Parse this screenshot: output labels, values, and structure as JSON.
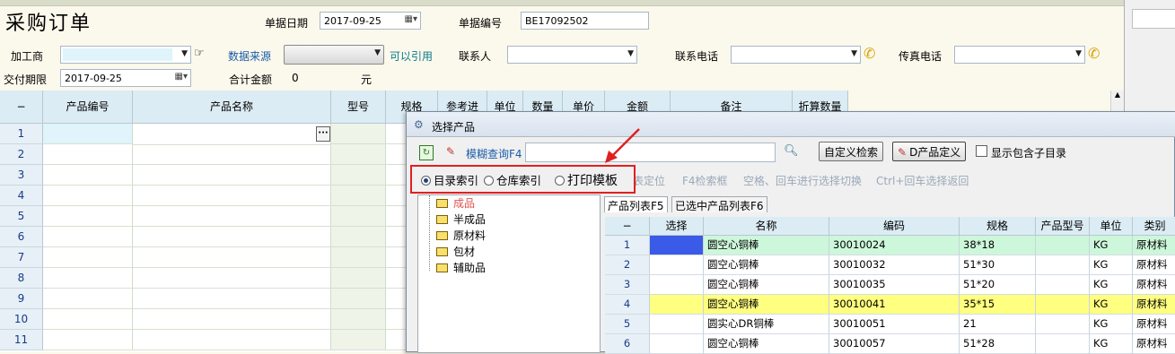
{
  "title": "采购订单",
  "header": {
    "date_label": "单据日期",
    "date_value": "2017-09-25",
    "doc_no_label": "单据编号",
    "doc_no_value": "BE17092502",
    "processor_label": "加工商",
    "processor_value": "",
    "source_label": "数据来源",
    "source_value": "",
    "quote_label": "可以引用",
    "contact_label": "联系人",
    "contact_value": "",
    "phone_label": "联系电话",
    "phone_value": "",
    "fax_label": "传真电话",
    "fax_value": "",
    "due_label": "交付期限",
    "due_value": "2017-09-25",
    "total_label": "合计金额",
    "total_value": "0",
    "currency": "元"
  },
  "grid": {
    "columns": [
      "−",
      "产品编号",
      "产品名称",
      "型号",
      "规格",
      "参考进",
      "单位",
      "数量",
      "单价",
      "金额",
      "备注",
      "折算数量"
    ],
    "rows": [
      "1",
      "2",
      "3",
      "4",
      "5",
      "6",
      "7",
      "8",
      "9",
      "10",
      "11"
    ],
    "cell_button": "···"
  },
  "dialog": {
    "title": "选择产品",
    "fuzzy_label": "模糊查询F4",
    "search_value": "",
    "custom_search": "自定义检索",
    "d_define": "D产品定义",
    "show_sub": "显示包含子目录",
    "radios": [
      {
        "label": "目录索引",
        "checked": true
      },
      {
        "label": "仓库索引",
        "checked": false
      },
      {
        "label": "打印模板",
        "checked": false
      }
    ],
    "hints": [
      "表定位",
      "F4检索框",
      "空格、回车进行选择切换",
      "Ctrl+回车选择返回"
    ],
    "tree": [
      "成品",
      "半成品",
      "原材料",
      "包材",
      "辅助品"
    ],
    "tabs": [
      "产品列表F5",
      "已选中产品列表F6"
    ],
    "table_columns": [
      "−",
      "选择",
      "名称",
      "编码",
      "规格",
      "产品型号",
      "单位",
      "类别"
    ],
    "table_rows": [
      {
        "n": "1",
        "name": "圆空心铜棒",
        "code": "30010024",
        "spec": "38*18",
        "model": "",
        "unit": "KG",
        "cat": "原材料"
      },
      {
        "n": "2",
        "name": "圆空心铜棒",
        "code": "30010032",
        "spec": "51*30",
        "model": "",
        "unit": "KG",
        "cat": "原材料"
      },
      {
        "n": "3",
        "name": "圆空心铜棒",
        "code": "30010035",
        "spec": "51*20",
        "model": "",
        "unit": "KG",
        "cat": "原材料"
      },
      {
        "n": "4",
        "name": "圆空心铜棒",
        "code": "30010041",
        "spec": "35*15",
        "model": "",
        "unit": "KG",
        "cat": "原材料"
      },
      {
        "n": "5",
        "name": "圆实心DR铜棒",
        "code": "30010051",
        "spec": "21",
        "model": "",
        "unit": "KG",
        "cat": "原材料"
      },
      {
        "n": "6",
        "name": "圆空心铜棒",
        "code": "30010057",
        "spec": "51*28",
        "model": "",
        "unit": "KG",
        "cat": "原材料"
      }
    ]
  }
}
